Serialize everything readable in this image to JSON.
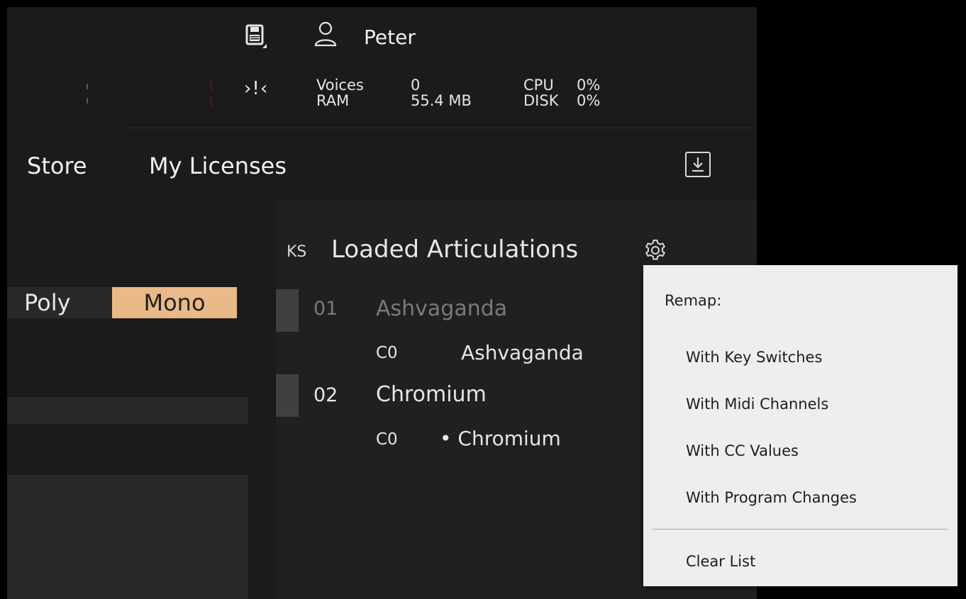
{
  "header": {
    "user_name": "Peter",
    "midi_indicator": "›!‹",
    "stats": {
      "voices_label": "Voices",
      "voices_value": "0",
      "ram_label": "RAM",
      "ram_value": "55.4 MB",
      "cpu_label": "CPU",
      "cpu_value": "0%",
      "disk_label": "DISK",
      "disk_value": "0%"
    }
  },
  "nav": {
    "store_label": "Store",
    "licenses_label": "My Licenses",
    "download_icon": "download-icon"
  },
  "left": {
    "poly_label": "Poly",
    "mono_label": "Mono"
  },
  "articulations": {
    "ks_label": "KS",
    "title": "Loaded Articulations",
    "items": [
      {
        "number": "01",
        "name": "Ashvaganda",
        "key": "C0",
        "sub_name": "Ashvaganda"
      },
      {
        "number": "02",
        "name": "Chromium",
        "key": "C0",
        "sub_name": "• Chromium"
      }
    ]
  },
  "menu": {
    "heading": "Remap:",
    "items": [
      "With Key Switches",
      "With Midi Channels",
      "With CC Values",
      "With Program Changes"
    ],
    "clear_label": "Clear List"
  },
  "colors": {
    "accent": "#e9b987",
    "background": "#1b1b1b",
    "menu_background": "#eeeeee"
  }
}
